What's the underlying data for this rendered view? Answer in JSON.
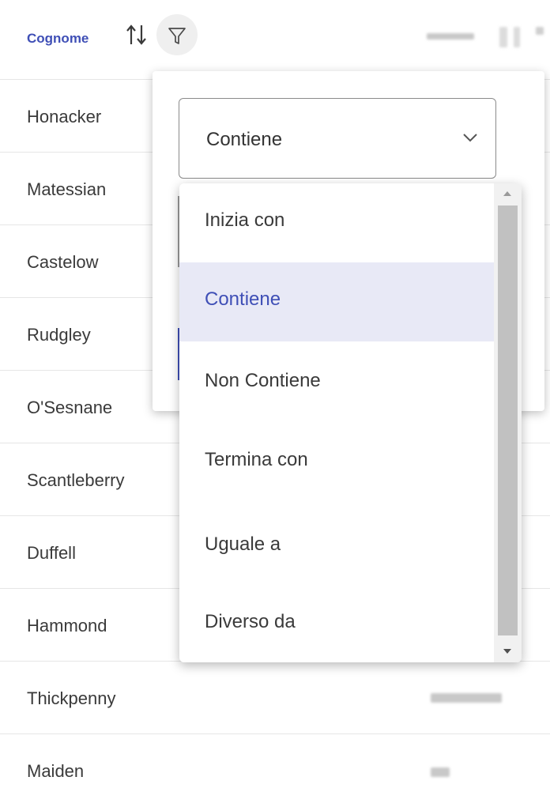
{
  "table": {
    "header": {
      "label": "Cognome"
    },
    "rows": [
      {
        "name": "Honacker"
      },
      {
        "name": "Matessian"
      },
      {
        "name": "Castelow"
      },
      {
        "name": "Rudgley"
      },
      {
        "name": "O'Sesnane"
      },
      {
        "name": "Scantleberry"
      },
      {
        "name": "Duffell"
      },
      {
        "name": "Hammond"
      },
      {
        "name": "Thickpenny"
      },
      {
        "name": "Maiden"
      }
    ]
  },
  "filter": {
    "selected_value": "Contiene",
    "options": [
      {
        "label": "Inizia con",
        "selected": false
      },
      {
        "label": "Contiene",
        "selected": true
      },
      {
        "label": "Non Contiene",
        "selected": false
      },
      {
        "label": "Termina con",
        "selected": false
      },
      {
        "label": "Uguale a",
        "selected": false
      },
      {
        "label": "Diverso da",
        "selected": false
      }
    ]
  },
  "icons": {
    "sort": "sort-arrows-icon",
    "filter": "funnel-icon",
    "select": "chevron-down-icon"
  },
  "colors": {
    "accent": "#3f4fb6",
    "selected_bg": "#e8e9f6",
    "row_border": "#e6e6e6"
  }
}
